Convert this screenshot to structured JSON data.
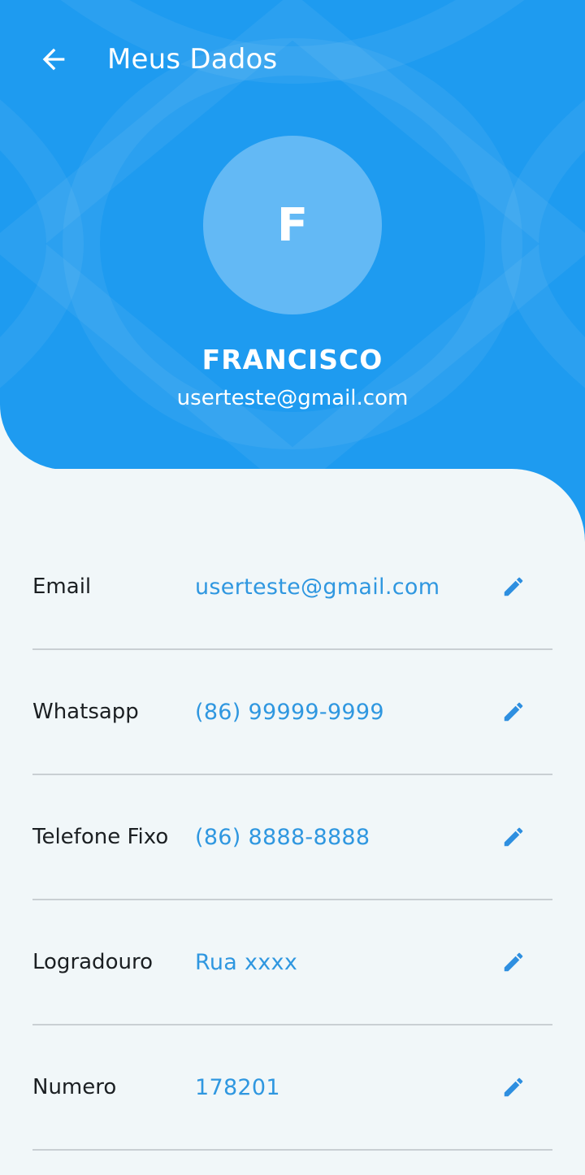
{
  "header": {
    "title": "Meus Dados",
    "back_icon": "arrow-left-icon",
    "background_color": "#1e9bf0"
  },
  "profile": {
    "avatar_initial": "F",
    "name": "FRANCISCO",
    "email": "userteste@gmail.com",
    "avatar_color": "#63b9f5"
  },
  "fields": [
    {
      "label": "Email",
      "value": "userteste@gmail.com",
      "icon": "pencil-icon"
    },
    {
      "label": "Whatsapp",
      "value": "(86) 99999-9999",
      "icon": "pencil-icon"
    },
    {
      "label": "Telefone Fixo",
      "value": "(86) 8888-8888",
      "icon": "pencil-icon"
    },
    {
      "label": "Logradouro",
      "value": "Rua xxxx",
      "icon": "pencil-icon"
    },
    {
      "label": "Numero",
      "value": "178201",
      "icon": "pencil-icon"
    }
  ],
  "colors": {
    "accent": "#1e9bf0",
    "value_text": "#2f97e0",
    "edit_icon": "#2e8fe0",
    "background": "#f1f7f9"
  }
}
